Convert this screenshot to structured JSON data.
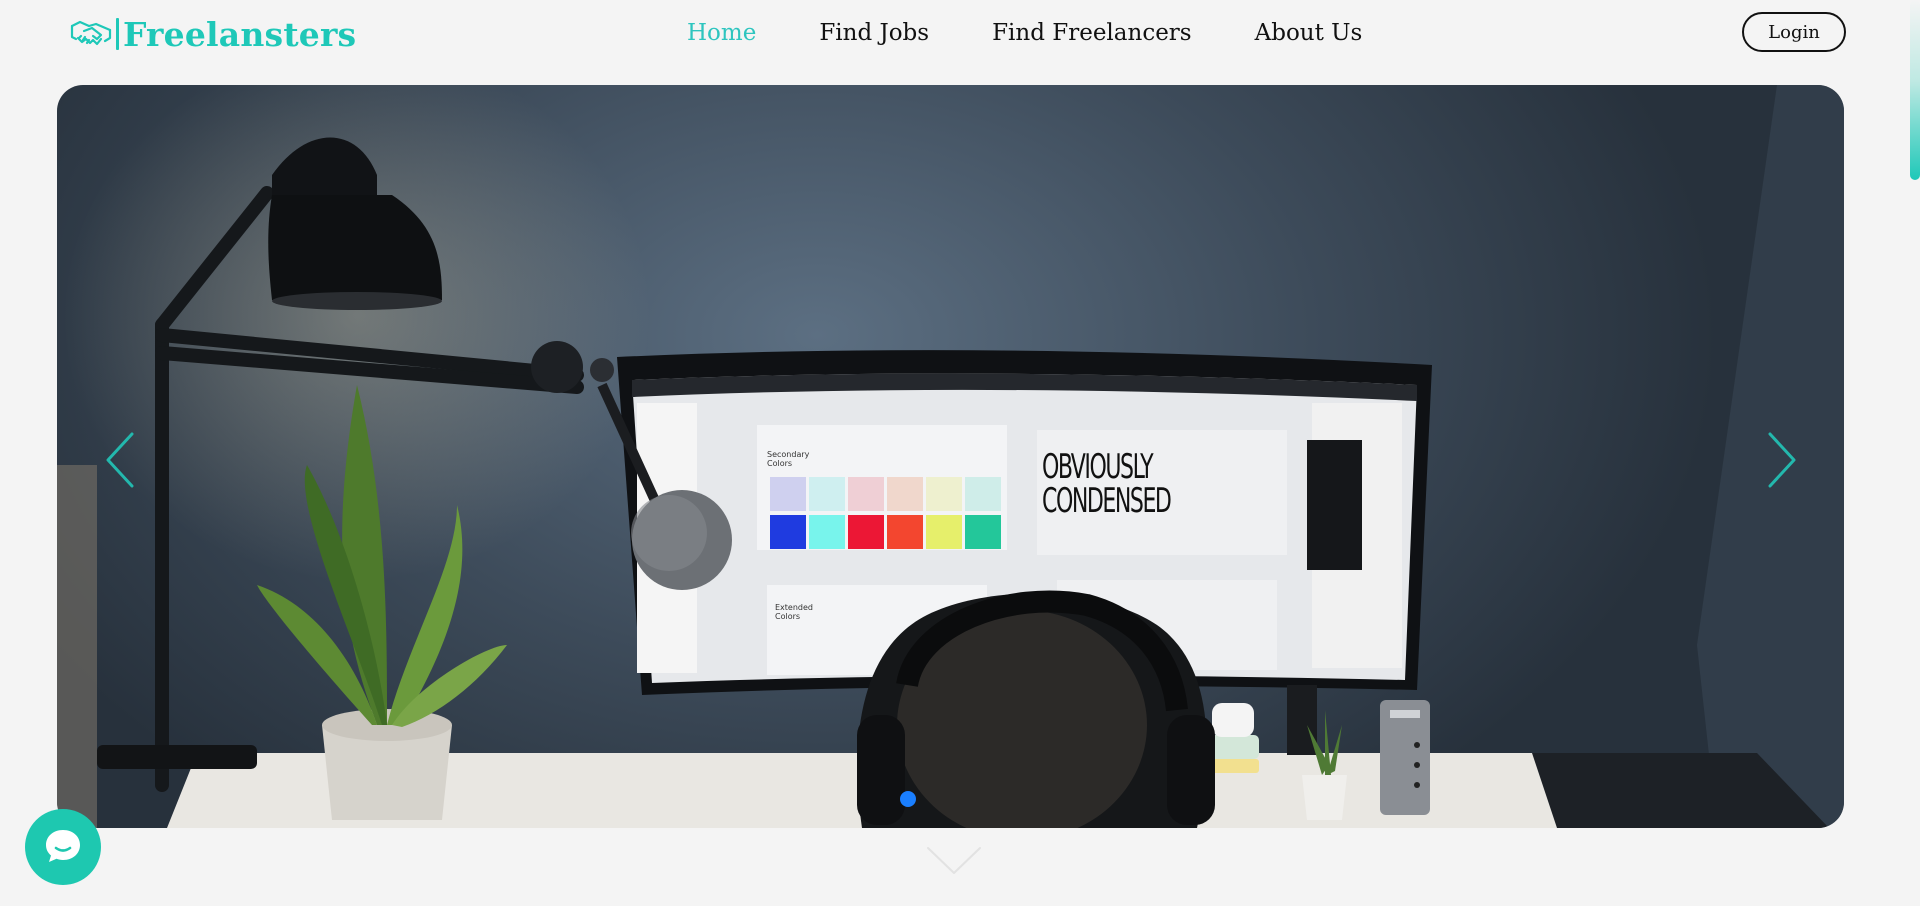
{
  "brand": {
    "name": "Freelansters",
    "logo_icon": "handshake-icon",
    "color": "#1ec8b8"
  },
  "nav": {
    "items": [
      {
        "label": "Home",
        "active": true
      },
      {
        "label": "Find Jobs",
        "active": false
      },
      {
        "label": "Find Freelancers",
        "active": false
      },
      {
        "label": "About Us",
        "active": false
      }
    ],
    "active_color": "#2ec5bf"
  },
  "header": {
    "login_label": "Login"
  },
  "hero": {
    "image_subject": "desk workspace photo with curved monitor, lamp, plant and person wearing headphones",
    "monitor_text": [
      "OBVIOUSLY",
      "CONDENSED"
    ],
    "monitor_small_text": [
      "Secondary",
      "Colors",
      "Extended",
      "Colors"
    ],
    "arrows": {
      "prev_icon": "chevron-left-icon",
      "next_icon": "chevron-right-icon",
      "color": "#23b8ad"
    },
    "dots": {
      "count": 1,
      "active_index": 0,
      "color": "#1a7fff"
    }
  },
  "scroll_down_icon": "chevron-down-icon",
  "chat": {
    "icon": "chat-bubble-icon",
    "color": "#1ec8b0"
  }
}
